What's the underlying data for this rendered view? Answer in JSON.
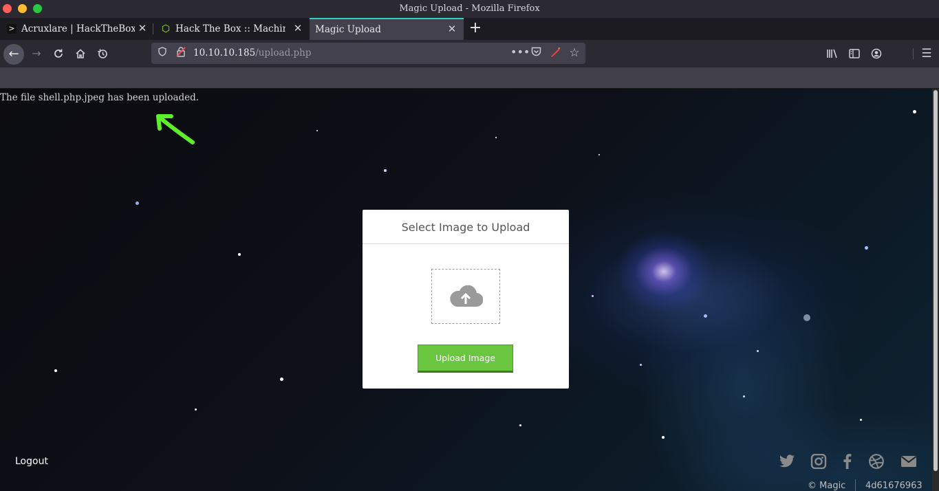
{
  "window": {
    "title": "Magic Upload - Mozilla Firefox"
  },
  "tabs": [
    {
      "label": "Acruxlare | HackTheBox -",
      "favicon": "terminal-icon",
      "active": false
    },
    {
      "label": "Hack The Box :: Machines",
      "favicon": "cube-icon",
      "active": false
    },
    {
      "label": "Magic Upload",
      "favicon": "",
      "active": true
    }
  ],
  "urlbar": {
    "host": "10.10.10.185",
    "path": "/upload.php"
  },
  "page": {
    "message": "The file shell.php.jpeg has been uploaded.",
    "card_title": "Select Image to Upload",
    "upload_button": "Upload Image",
    "logout": "Logout",
    "copyright": "© Magic",
    "hash": "4d61676963",
    "social_icons": [
      "twitter-icon",
      "instagram-icon",
      "facebook-icon",
      "dribbble-icon",
      "mail-icon"
    ]
  },
  "colors": {
    "accent_tab": "#2dd4bf",
    "button_green": "#6ac63e",
    "annotation_arrow": "#5df02a"
  }
}
